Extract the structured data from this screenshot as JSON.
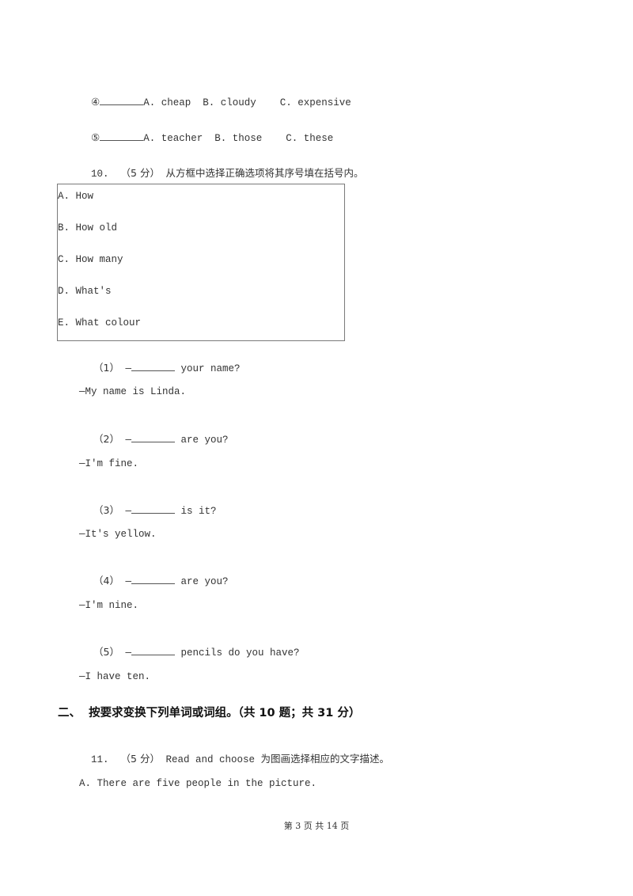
{
  "question9_items": [
    {
      "marker": "④",
      "options": "A. cheap  B. cloudy    C. expensive"
    },
    {
      "marker": "⑤",
      "options": "A. teacher  B. those    C. these"
    }
  ],
  "question10": {
    "number": "10.",
    "score": "（5 分）",
    "instruction": "从方框中选择正确选项将其序号填在括号内。",
    "box_options": [
      "A. How",
      "B. How old",
      "C. How many",
      "D. What's",
      "E. What colour"
    ],
    "dialogues": [
      {
        "label": "（1）",
        "dash": "—",
        "question_rest": " your name?",
        "answer": "—My name is Linda."
      },
      {
        "label": "（2）",
        "dash": "—",
        "question_rest": " are you?",
        "answer": "—I'm fine."
      },
      {
        "label": "（3）",
        "dash": "—",
        "question_rest": " is it?",
        "answer": "—It's yellow."
      },
      {
        "label": "（4）",
        "dash": "—",
        "question_rest": " are you?",
        "answer": "—I'm nine."
      },
      {
        "label": "（5）",
        "dash": "—",
        "question_rest": " pencils do you have?",
        "answer": "—I have ten."
      }
    ]
  },
  "section2": {
    "heading": "二、  按要求变换下列单词或词组。（共 10 题；共 31 分）"
  },
  "question11": {
    "number": "11.",
    "score": "（5 分）",
    "instruction_en": "Read and choose",
    "instruction_cn": "为图画选择相应的文字描述。",
    "option_a": "A. There are five people in the picture."
  },
  "footer": {
    "page_text": "第 3 页 共 14 页"
  }
}
